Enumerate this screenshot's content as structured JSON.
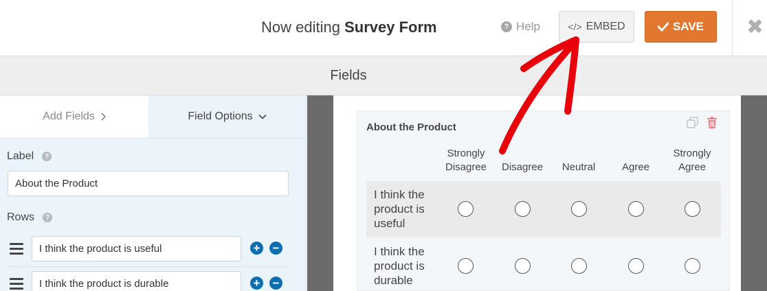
{
  "header": {
    "title_prefix": "Now editing",
    "form_name": "Survey Form",
    "help_label": "Help",
    "embed_label": "EMBED",
    "save_label": "SAVE",
    "close_symbol": "✖",
    "colors": {
      "save_bg": "#e27730",
      "annotation_arrow": "#e8000b"
    }
  },
  "fields_bar": {
    "title": "Fields"
  },
  "panel": {
    "tabs": [
      {
        "label": "Add Fields",
        "icon": "chevron-right-icon"
      },
      {
        "label": "Field Options",
        "icon": "chevron-down-icon",
        "active": true
      }
    ],
    "label_caption": "Label",
    "label_value": "About the Product",
    "rows_caption": "Rows",
    "rows": [
      {
        "value": "I think the product is useful"
      },
      {
        "value": "I think the product is durable"
      }
    ]
  },
  "preview": {
    "field_title": "About the Product",
    "columns": [
      {
        "line1": "Strongly",
        "line2": "Disagree"
      },
      {
        "line1": "",
        "line2": "Disagree"
      },
      {
        "line1": "",
        "line2": "Neutral"
      },
      {
        "line1": "",
        "line2": "Agree"
      },
      {
        "line1": "Strongly",
        "line2": "Agree"
      }
    ],
    "rows": [
      {
        "line1": "I think the",
        "line2": "product is",
        "line3": "useful"
      },
      {
        "line1": "I think the",
        "line2": "product is",
        "line3": "durable"
      }
    ]
  }
}
